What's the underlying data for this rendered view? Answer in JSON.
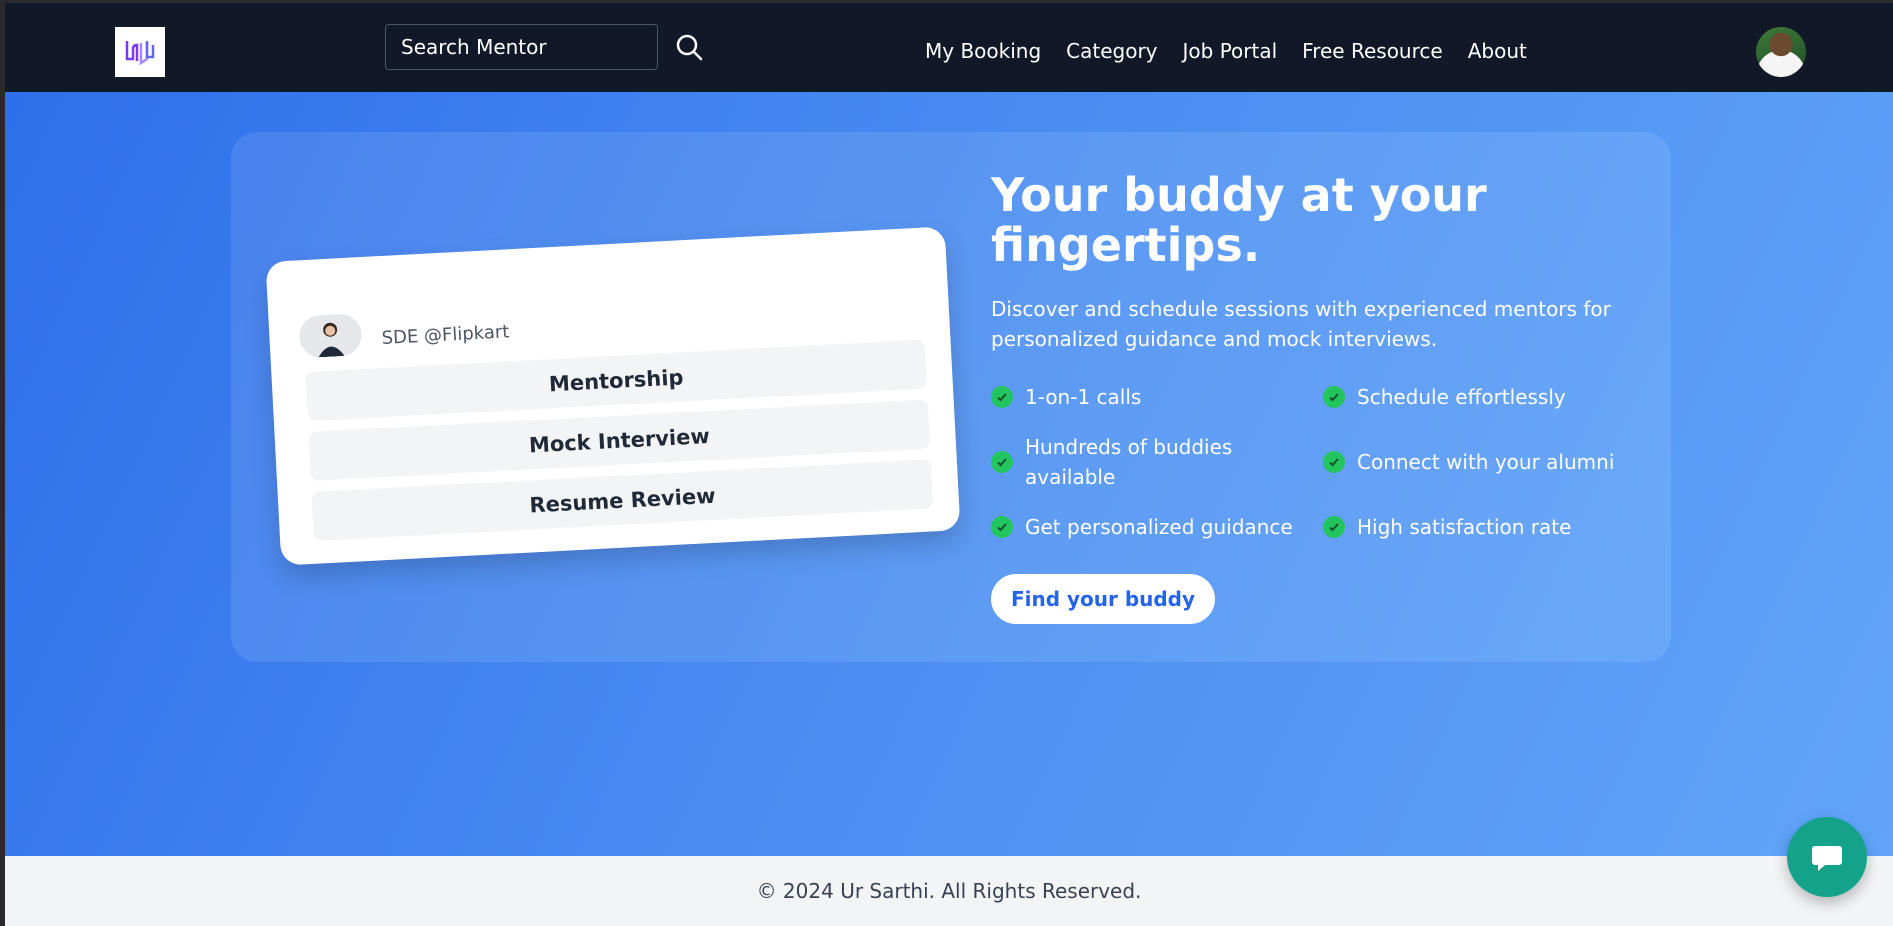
{
  "header": {
    "search": {
      "placeholder": "Search Mentor",
      "value": ""
    },
    "nav": [
      {
        "label": "My Booking"
      },
      {
        "label": "Category"
      },
      {
        "label": "Job Portal"
      },
      {
        "label": "Free Resource"
      },
      {
        "label": "About"
      }
    ]
  },
  "hero": {
    "mentor_card": {
      "role": "SDE @Flipkart",
      "services": [
        "Mentorship",
        "Mock Interview",
        "Resume Review"
      ]
    },
    "title": "Your buddy at your fingertips.",
    "description": "Discover and schedule sessions with experienced mentors for personalized guidance and mock interviews.",
    "features": [
      "1-on-1 calls",
      "Schedule effortlessly",
      "Hundreds of buddies available",
      "Connect with your alumni",
      "Get personalized guidance",
      "High satisfaction rate"
    ],
    "cta_label": "Find your buddy"
  },
  "footer": {
    "copyright": "© 2024 Ur Sarthi. All Rights Reserved."
  },
  "icons": {
    "search": "search-icon",
    "check": "check-circle-icon",
    "chat": "chat-bubble-icon"
  },
  "colors": {
    "header_bg": "#111827",
    "hero_gradient_start": "#2e6feb",
    "hero_gradient_end": "#60a5fa",
    "check_green": "#22c55e",
    "cta_text": "#2563eb",
    "chat_button": "#14a38a"
  }
}
